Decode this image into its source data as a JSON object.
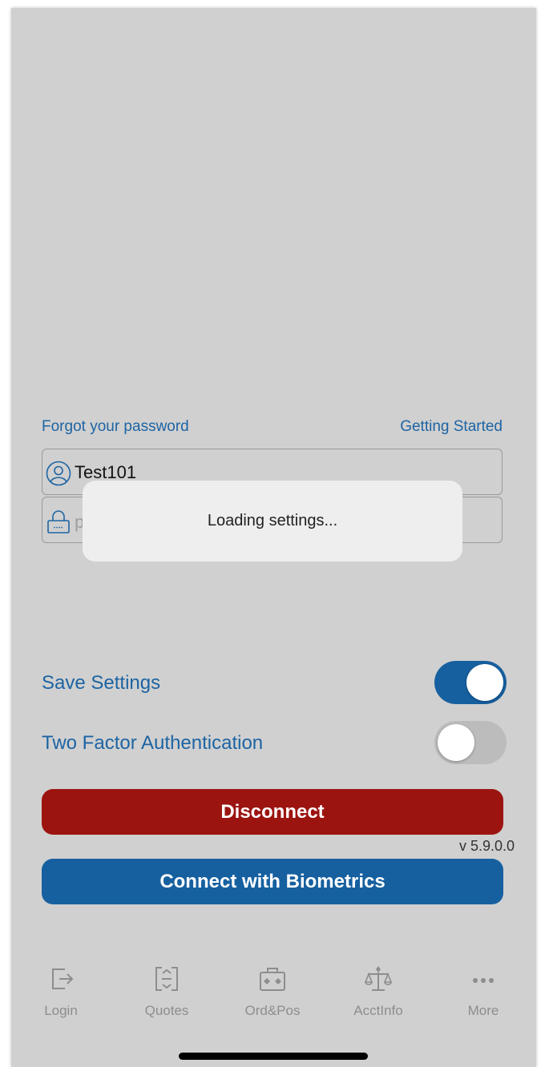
{
  "links": {
    "forgot_password": "Forgot your password",
    "getting_started": "Getting Started"
  },
  "login": {
    "username_value": "Test101",
    "password_placeholder_visible": "p"
  },
  "toast": {
    "message": "Loading settings..."
  },
  "settings": {
    "save_settings_label": "Save Settings",
    "save_settings_on": true,
    "two_factor_label": "Two Factor Authentication",
    "two_factor_on": false
  },
  "buttons": {
    "disconnect": "Disconnect",
    "connect_biometrics": "Connect with Biometrics"
  },
  "version": "v 5.9.0.0",
  "tabs": [
    {
      "label": "Login",
      "icon": "login-icon"
    },
    {
      "label": "Quotes",
      "icon": "quotes-icon"
    },
    {
      "label": "Ord&Pos",
      "icon": "orders-positions-icon"
    },
    {
      "label": "AcctInfo",
      "icon": "account-info-icon"
    },
    {
      "label": "More",
      "icon": "more-icon"
    }
  ],
  "colors": {
    "background": "#d0d0d0",
    "accent_blue": "#1d64a3",
    "disconnect_red": "#9c1410",
    "biometrics_blue": "#1660a0",
    "toggle_on": "#1660a0",
    "toggle_off": "#bcbcbc"
  }
}
